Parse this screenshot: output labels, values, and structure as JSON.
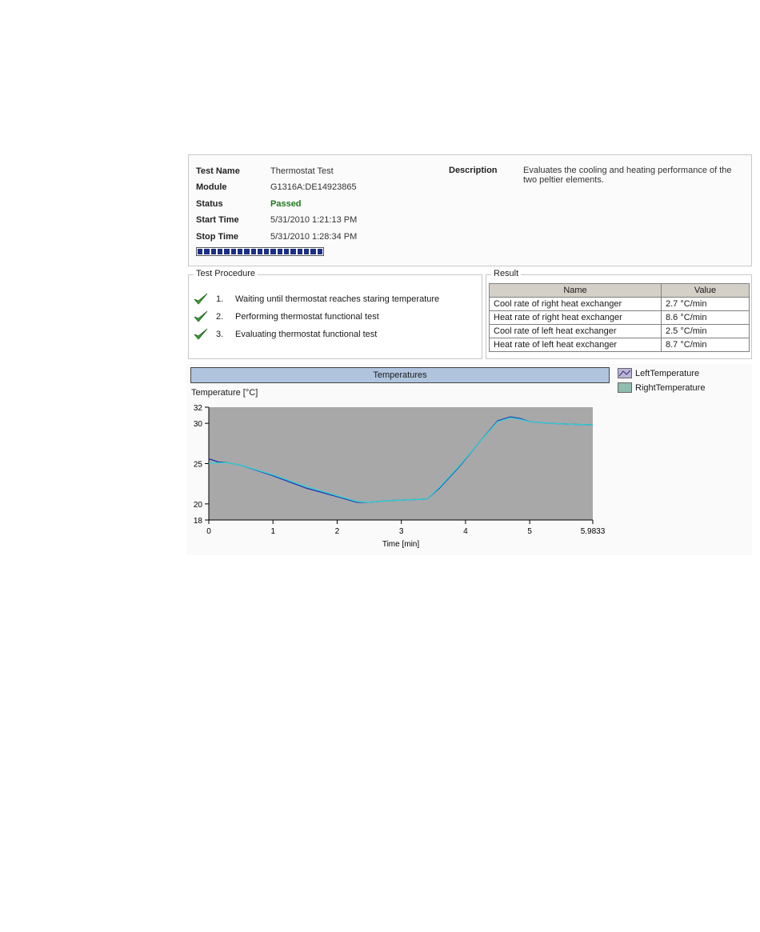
{
  "info": {
    "test_name_label": "Test Name",
    "test_name": "Thermostat Test",
    "module_label": "Module",
    "module": "G1316A:DE14923865",
    "status_label": "Status",
    "status": "Passed",
    "start_label": "Start Time",
    "start_time": "5/31/2010 1:21:13 PM",
    "stop_label": "Stop Time",
    "stop_time": "5/31/2010 1:28:34 PM",
    "description_label": "Description",
    "description": "Evaluates the cooling and heating performance of the two peltier elements.",
    "progress": 1.0
  },
  "procedure": {
    "title": "Test Procedure",
    "steps": [
      {
        "num": "1.",
        "text": "Waiting until thermostat reaches staring temperature"
      },
      {
        "num": "2.",
        "text": "Performing thermostat functional test"
      },
      {
        "num": "3.",
        "text": "Evaluating thermostat functional test"
      }
    ]
  },
  "result": {
    "title": "Result",
    "columns": [
      "Name",
      "Value"
    ],
    "rows": [
      [
        "Cool rate of right heat exchanger",
        "2.7 °C/min"
      ],
      [
        "Heat rate of right heat exchanger",
        "8.6 °C/min"
      ],
      [
        "Cool rate of left heat exchanger",
        "2.5 °C/min"
      ],
      [
        "Heat rate of left heat exchanger",
        "8.7 °C/min"
      ]
    ]
  },
  "colors": {
    "plot_bg": "#a8a8a8",
    "left_line": "#1a2fb8",
    "right_line": "#2ed3d3",
    "title_bg": "#b0c4de",
    "passed": "#1f7a1f",
    "progress": "#1b2f86"
  },
  "chart_data": {
    "type": "line",
    "title": "Temperatures",
    "ylabel": "Temperature [°C]",
    "xlabel": "Time [min]",
    "xlim": [
      0,
      5.9833
    ],
    "ylim": [
      18,
      32
    ],
    "xticks": [
      0,
      1,
      2,
      3,
      4,
      5,
      5.9833
    ],
    "xtick_labels": [
      "0",
      "1",
      "2",
      "3",
      "4",
      "5",
      "5.9833"
    ],
    "yticks": [
      18,
      20,
      25,
      30,
      32
    ],
    "ytick_labels": [
      "18",
      "20",
      "25",
      "30",
      "32"
    ],
    "grid": false,
    "legend_position": "right",
    "series": [
      {
        "name": "LeftTemperature",
        "x": [
          0,
          0.15,
          0.3,
          0.5,
          1.0,
          1.5,
          2.0,
          2.3,
          2.5,
          2.8,
          3.1,
          3.4,
          3.6,
          3.9,
          4.2,
          4.5,
          4.7,
          4.85,
          5.0,
          5.3,
          5.6,
          5.9833
        ],
        "y": [
          25.6,
          25.2,
          25.1,
          24.8,
          23.5,
          22.0,
          20.9,
          20.2,
          20.2,
          20.4,
          20.5,
          20.6,
          22.0,
          24.6,
          27.5,
          30.3,
          30.8,
          30.6,
          30.2,
          30.0,
          29.9,
          29.8
        ]
      },
      {
        "name": "RightTemperature",
        "x": [
          0,
          0.15,
          0.3,
          0.5,
          1.0,
          1.5,
          2.0,
          2.3,
          2.5,
          2.8,
          3.1,
          3.4,
          3.6,
          3.9,
          4.2,
          4.5,
          4.7,
          4.85,
          5.0,
          5.3,
          5.6,
          5.9833
        ],
        "y": [
          25.0,
          25.1,
          25.1,
          24.8,
          23.6,
          22.2,
          21.0,
          20.3,
          20.2,
          20.4,
          20.5,
          20.6,
          22.1,
          24.7,
          27.5,
          30.2,
          30.7,
          30.5,
          30.2,
          30.0,
          29.9,
          29.8
        ]
      }
    ]
  }
}
